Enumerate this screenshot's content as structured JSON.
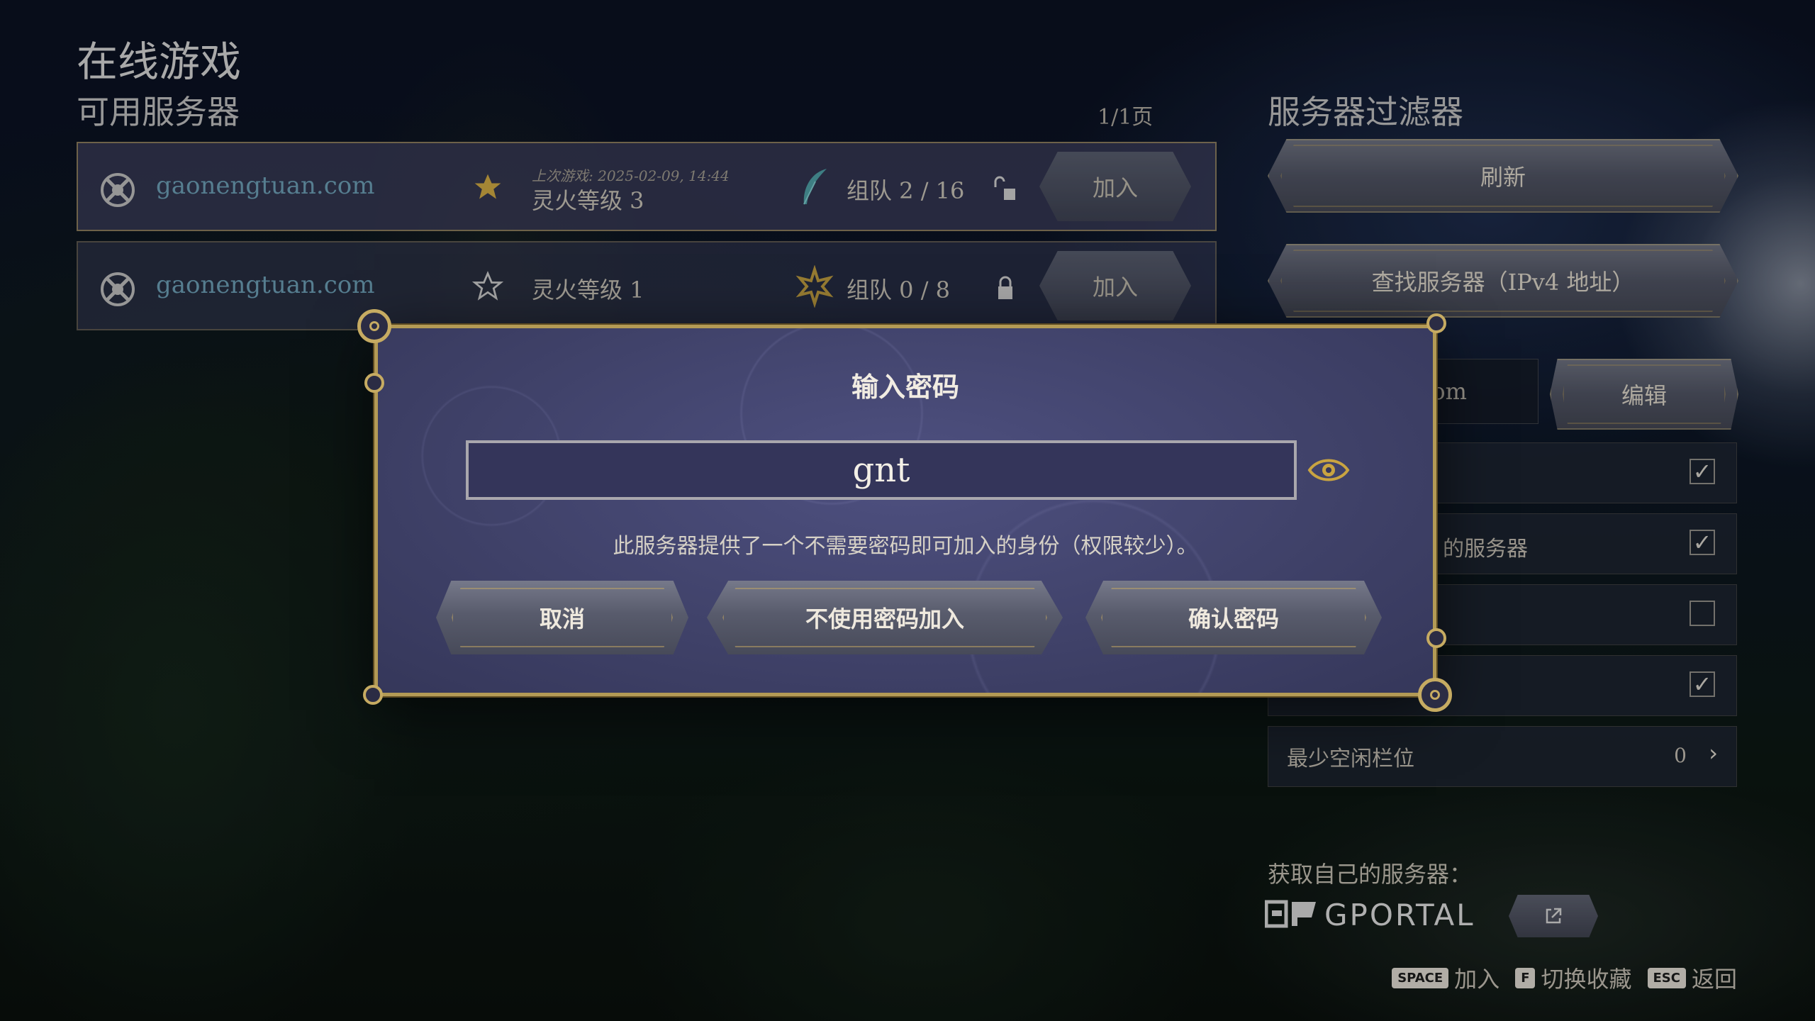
{
  "header": {
    "title": "在线游戏",
    "subtitle": "可用服务器",
    "page_indicator": "1/1页"
  },
  "servers": [
    {
      "name": "gaonengtuan.com",
      "favorite": true,
      "last_played": "上次游戏: 2025-02-09, 14:44",
      "level": "灵火等级 3",
      "party": "组队 2 / 16",
      "join_label": "加入"
    },
    {
      "name": "gaonengtuan.com",
      "favorite": false,
      "level": "灵火等级 1",
      "party": "组队 0 / 8",
      "join_label": "加入"
    }
  ],
  "filter_panel": {
    "title": "服务器过滤器",
    "refresh_label": "刷新",
    "find_label": "查找服务器（IPv4 地址）",
    "name_field_visible": "om",
    "edit_label": "编辑",
    "options": [
      {
        "label": "",
        "checked": true
      },
      {
        "label": "的服务器",
        "checked": true
      },
      {
        "label": "",
        "checked": false
      },
      {
        "label": "",
        "checked": true
      }
    ],
    "min_slots_label": "最少空闲栏位",
    "min_slots_value": "0",
    "get_server_label": "获取自己的服务器：",
    "gportal_text": "GPORTAL"
  },
  "hints": [
    {
      "key": "SPACE",
      "label": "加入"
    },
    {
      "key": "F",
      "label": "切换收藏"
    },
    {
      "key": "ESC",
      "label": "返回"
    }
  ],
  "modal": {
    "title": "输入密码",
    "password_value": "gnt",
    "note": "此服务器提供了一个不需要密码即可加入的身份（权限较少）。",
    "cancel_label": "取消",
    "join_without_pw_label": "不使用密码加入",
    "confirm_label": "确认密码"
  },
  "colors": {
    "gold_border": "#b39a55",
    "server_name": "#6a9ab0",
    "modal_bg": "#3f4168"
  }
}
